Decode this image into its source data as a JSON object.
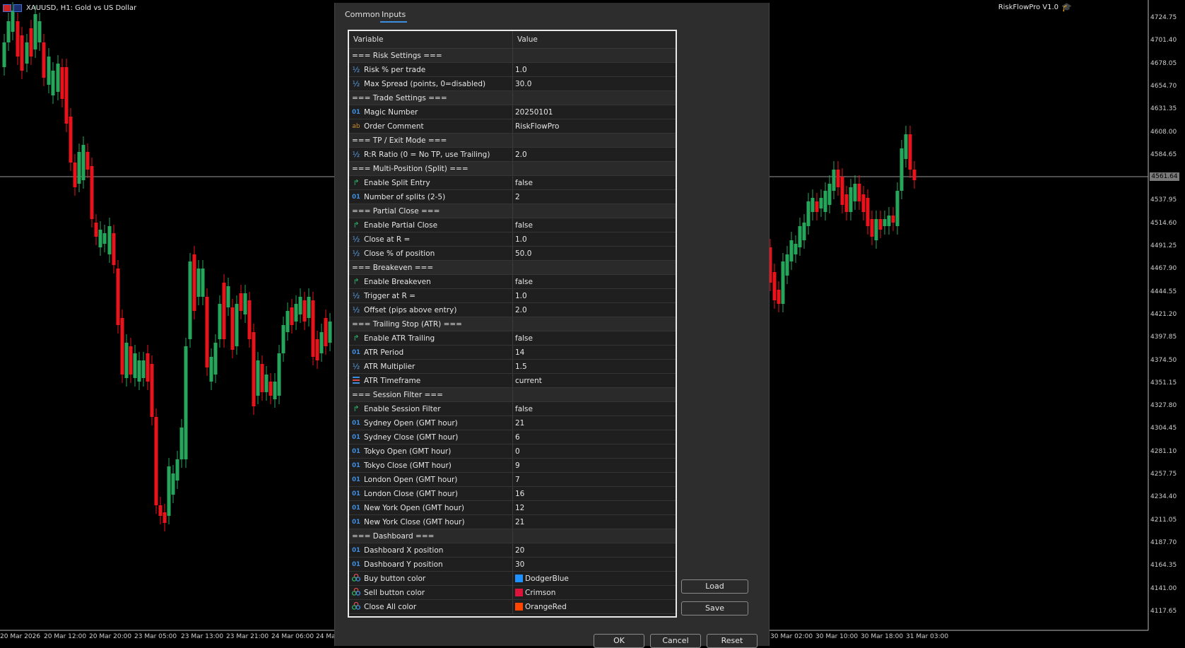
{
  "window": {
    "symbol_title": "XAUUSD, H1:  Gold vs US Dollar",
    "ea_label": "RiskFlowPro V1.0"
  },
  "price_axis": {
    "labels": [
      "4724.75",
      "4701.40",
      "4678.05",
      "4654.70",
      "4631.35",
      "4608.00",
      "4584.65",
      "4537.95",
      "4514.60",
      "4491.25",
      "4467.90",
      "4444.55",
      "4421.20",
      "4397.85",
      "4374.50",
      "4351.15",
      "4327.80",
      "4304.45",
      "4281.10",
      "4257.75",
      "4234.40",
      "4211.05",
      "4187.70",
      "4164.35",
      "4141.00",
      "4117.65"
    ],
    "current": "4561.64"
  },
  "time_axis": {
    "left": [
      "20 Mar 2026",
      "20 Mar 12:00",
      "20 Mar 20:00",
      "23 Mar 05:00",
      "23 Mar 13:00",
      "23 Mar 21:00",
      "24 Mar 06:00",
      "24 Ma"
    ],
    "right": [
      "30 Mar 02:00",
      "30 Mar 10:00",
      "30 Mar 18:00",
      "31 Mar 03:00"
    ]
  },
  "colors": {
    "bull": "#26a65b",
    "bear": "#e8131b",
    "grid_line": "#9a9a9a"
  },
  "dialog": {
    "tabs": [
      {
        "label": "Common"
      },
      {
        "label": "Inputs"
      }
    ],
    "active_tab": "Inputs",
    "columns": {
      "variable": "Variable",
      "value": "Value"
    },
    "rows": [
      {
        "type": "section",
        "name": "=== Risk Settings ===",
        "value": ""
      },
      {
        "type": "double",
        "name": "Risk % per trade",
        "value": "1.0"
      },
      {
        "type": "double",
        "name": "Max Spread (points, 0=disabled)",
        "value": "30.0"
      },
      {
        "type": "section",
        "name": "=== Trade Settings ===",
        "value": ""
      },
      {
        "type": "int",
        "name": "Magic Number",
        "value": "20250101"
      },
      {
        "type": "string",
        "name": "Order Comment",
        "value": "RiskFlowPro"
      },
      {
        "type": "section",
        "name": "=== TP / Exit Mode ===",
        "value": ""
      },
      {
        "type": "double",
        "name": "R:R Ratio (0 = No TP, use Trailing)",
        "value": "2.0"
      },
      {
        "type": "section",
        "name": "=== Multi-Position (Split) ===",
        "value": ""
      },
      {
        "type": "bool",
        "name": "Enable Split Entry",
        "value": "false"
      },
      {
        "type": "int",
        "name": "Number of splits (2-5)",
        "value": "2"
      },
      {
        "type": "section",
        "name": "=== Partial Close ===",
        "value": ""
      },
      {
        "type": "bool",
        "name": "Enable Partial Close",
        "value": "false"
      },
      {
        "type": "double",
        "name": "Close at R =",
        "value": "1.0"
      },
      {
        "type": "double",
        "name": "Close % of position",
        "value": "50.0"
      },
      {
        "type": "section",
        "name": "=== Breakeven ===",
        "value": ""
      },
      {
        "type": "bool",
        "name": "Enable Breakeven",
        "value": "false"
      },
      {
        "type": "double",
        "name": "Trigger at R =",
        "value": "1.0"
      },
      {
        "type": "double",
        "name": "Offset (pips above entry)",
        "value": "2.0"
      },
      {
        "type": "section",
        "name": "=== Trailing Stop (ATR) ===",
        "value": ""
      },
      {
        "type": "bool",
        "name": "Enable ATR Trailing",
        "value": "false"
      },
      {
        "type": "int",
        "name": "ATR Period",
        "value": "14"
      },
      {
        "type": "double",
        "name": "ATR Multiplier",
        "value": "1.5"
      },
      {
        "type": "enum",
        "name": "ATR Timeframe",
        "value": "current"
      },
      {
        "type": "section",
        "name": "=== Session Filter ===",
        "value": ""
      },
      {
        "type": "bool",
        "name": "Enable Session Filter",
        "value": "false"
      },
      {
        "type": "int",
        "name": "Sydney Open (GMT hour)",
        "value": "21"
      },
      {
        "type": "int",
        "name": "Sydney Close (GMT hour)",
        "value": "6"
      },
      {
        "type": "int",
        "name": "Tokyo Open (GMT hour)",
        "value": "0"
      },
      {
        "type": "int",
        "name": "Tokyo Close (GMT hour)",
        "value": "9"
      },
      {
        "type": "int",
        "name": "London Open (GMT hour)",
        "value": "7"
      },
      {
        "type": "int",
        "name": "London Close (GMT hour)",
        "value": "16"
      },
      {
        "type": "int",
        "name": "New York Open (GMT hour)",
        "value": "12"
      },
      {
        "type": "int",
        "name": "New York Close (GMT hour)",
        "value": "21"
      },
      {
        "type": "section",
        "name": "=== Dashboard ===",
        "value": ""
      },
      {
        "type": "int",
        "name": "Dashboard X position",
        "value": "20"
      },
      {
        "type": "int",
        "name": "Dashboard Y position",
        "value": "30"
      },
      {
        "type": "color",
        "name": "Buy button color",
        "value": "DodgerBlue",
        "swatch": "#1e90ff"
      },
      {
        "type": "color",
        "name": "Sell button color",
        "value": "Crimson",
        "swatch": "#dc143c"
      },
      {
        "type": "color",
        "name": "Close All color",
        "value": "OrangeRed",
        "swatch": "#ff4500"
      }
    ],
    "buttons": {
      "load": "Load",
      "save": "Save",
      "ok": "OK",
      "cancel": "Cancel",
      "reset": "Reset"
    }
  }
}
